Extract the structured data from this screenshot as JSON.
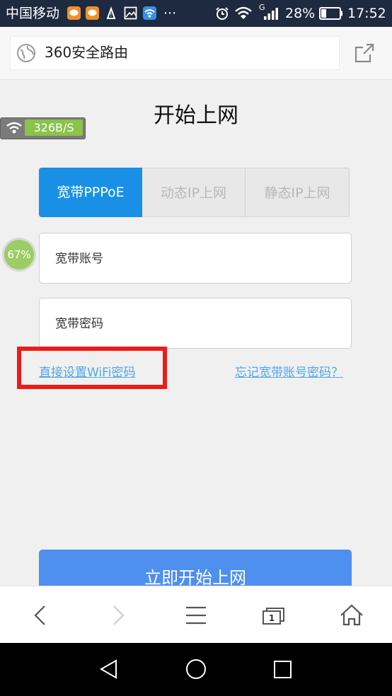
{
  "status_bar": {
    "carrier": "中国移动",
    "ellipsis": "···",
    "signal_g": "G",
    "battery_percent": "28%",
    "time": "17:52"
  },
  "address_bar": {
    "site_title": "360安全路由"
  },
  "page": {
    "title": "开始上网",
    "speed_indicator": "326B/S",
    "progress_badge": "67%",
    "tabs": [
      {
        "label": "宽带PPPoE",
        "active": true
      },
      {
        "label": "动态IP上网",
        "active": false
      },
      {
        "label": "静态IP上网",
        "active": false
      }
    ],
    "account_placeholder": "宽带账号",
    "password_placeholder": "宽带密码",
    "wifi_link": "直接设置WiFi密码",
    "forgot_link": "忘记宽带账号密码？",
    "start_button": "立即开始上网"
  },
  "toolbar": {
    "tab_count": "1"
  },
  "colors": {
    "accent": "#1990e5",
    "button": "#4e8ff0",
    "link": "#4fa7ea",
    "highlight": "#ee1b1b",
    "status_bar": "#1d2a3f"
  }
}
